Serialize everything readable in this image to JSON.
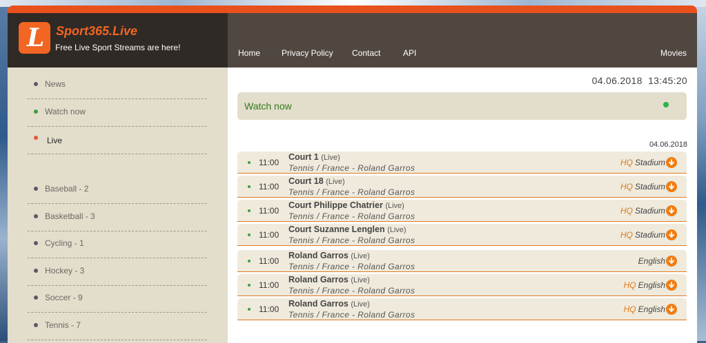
{
  "brand": {
    "logo_letter": "L",
    "name": "Sport365.Live",
    "tagline": "Free Live Sport Streams are here!"
  },
  "nav": {
    "home": "Home",
    "privacy": "Privacy Policy",
    "contact": "Contact",
    "api": "API",
    "movies": "Movies"
  },
  "sidebar": {
    "top_items": [
      {
        "label": "News",
        "dot": "#5a5a66"
      },
      {
        "label": "Watch now",
        "dot": "#3aa142"
      },
      {
        "label": "Live",
        "dot": "#e05a3a"
      }
    ],
    "sports": [
      {
        "label": "Baseball - 2"
      },
      {
        "label": "Basketball - 3"
      },
      {
        "label": "Cycling - 1"
      },
      {
        "label": "Hockey - 3"
      },
      {
        "label": "Soccer - 9"
      },
      {
        "label": "Tennis - 7"
      }
    ]
  },
  "main": {
    "date": "04.06.2018",
    "time": "13:45:20",
    "watch_now": "Watch now",
    "list_date": "04.06.2018",
    "events": [
      {
        "time": "11:00",
        "title": "Court 1",
        "status": "(Live)",
        "subtitle": "Tennis / France - Roland Garros",
        "hq": "HQ",
        "stream": "Stadium"
      },
      {
        "time": "11:00",
        "title": "Court 18",
        "status": "(Live)",
        "subtitle": "Tennis / France - Roland Garros",
        "hq": "HQ",
        "stream": "Stadium"
      },
      {
        "time": "11:00",
        "title": "Court Philippe Chatrier",
        "status": "(Live)",
        "subtitle": "Tennis / France - Roland Garros",
        "hq": "HQ",
        "stream": "Stadium"
      },
      {
        "time": "11:00",
        "title": "Court Suzanne Lenglen",
        "status": "(Live)",
        "subtitle": "Tennis / France - Roland Garros",
        "hq": "HQ",
        "stream": "Stadium"
      },
      {
        "time": "11:00",
        "title": "Roland Garros",
        "status": "(Live)",
        "subtitle": "Tennis / France - Roland Garros",
        "hq": "",
        "stream": "English"
      },
      {
        "time": "11:00",
        "title": "Roland Garros",
        "status": "(Live)",
        "subtitle": "Tennis / France - Roland Garros",
        "hq": "HQ",
        "stream": "English"
      },
      {
        "time": "11:00",
        "title": "Roland Garros",
        "status": "(Live)",
        "subtitle": "Tennis / France - Roland Garros",
        "hq": "HQ",
        "stream": "English"
      }
    ]
  },
  "colors": {
    "accent": "#f26522",
    "header_dark": "#2f2a26",
    "header_nav": "#504741",
    "sidebar_bg": "#e3ddcc",
    "live_green": "#2db34a"
  }
}
